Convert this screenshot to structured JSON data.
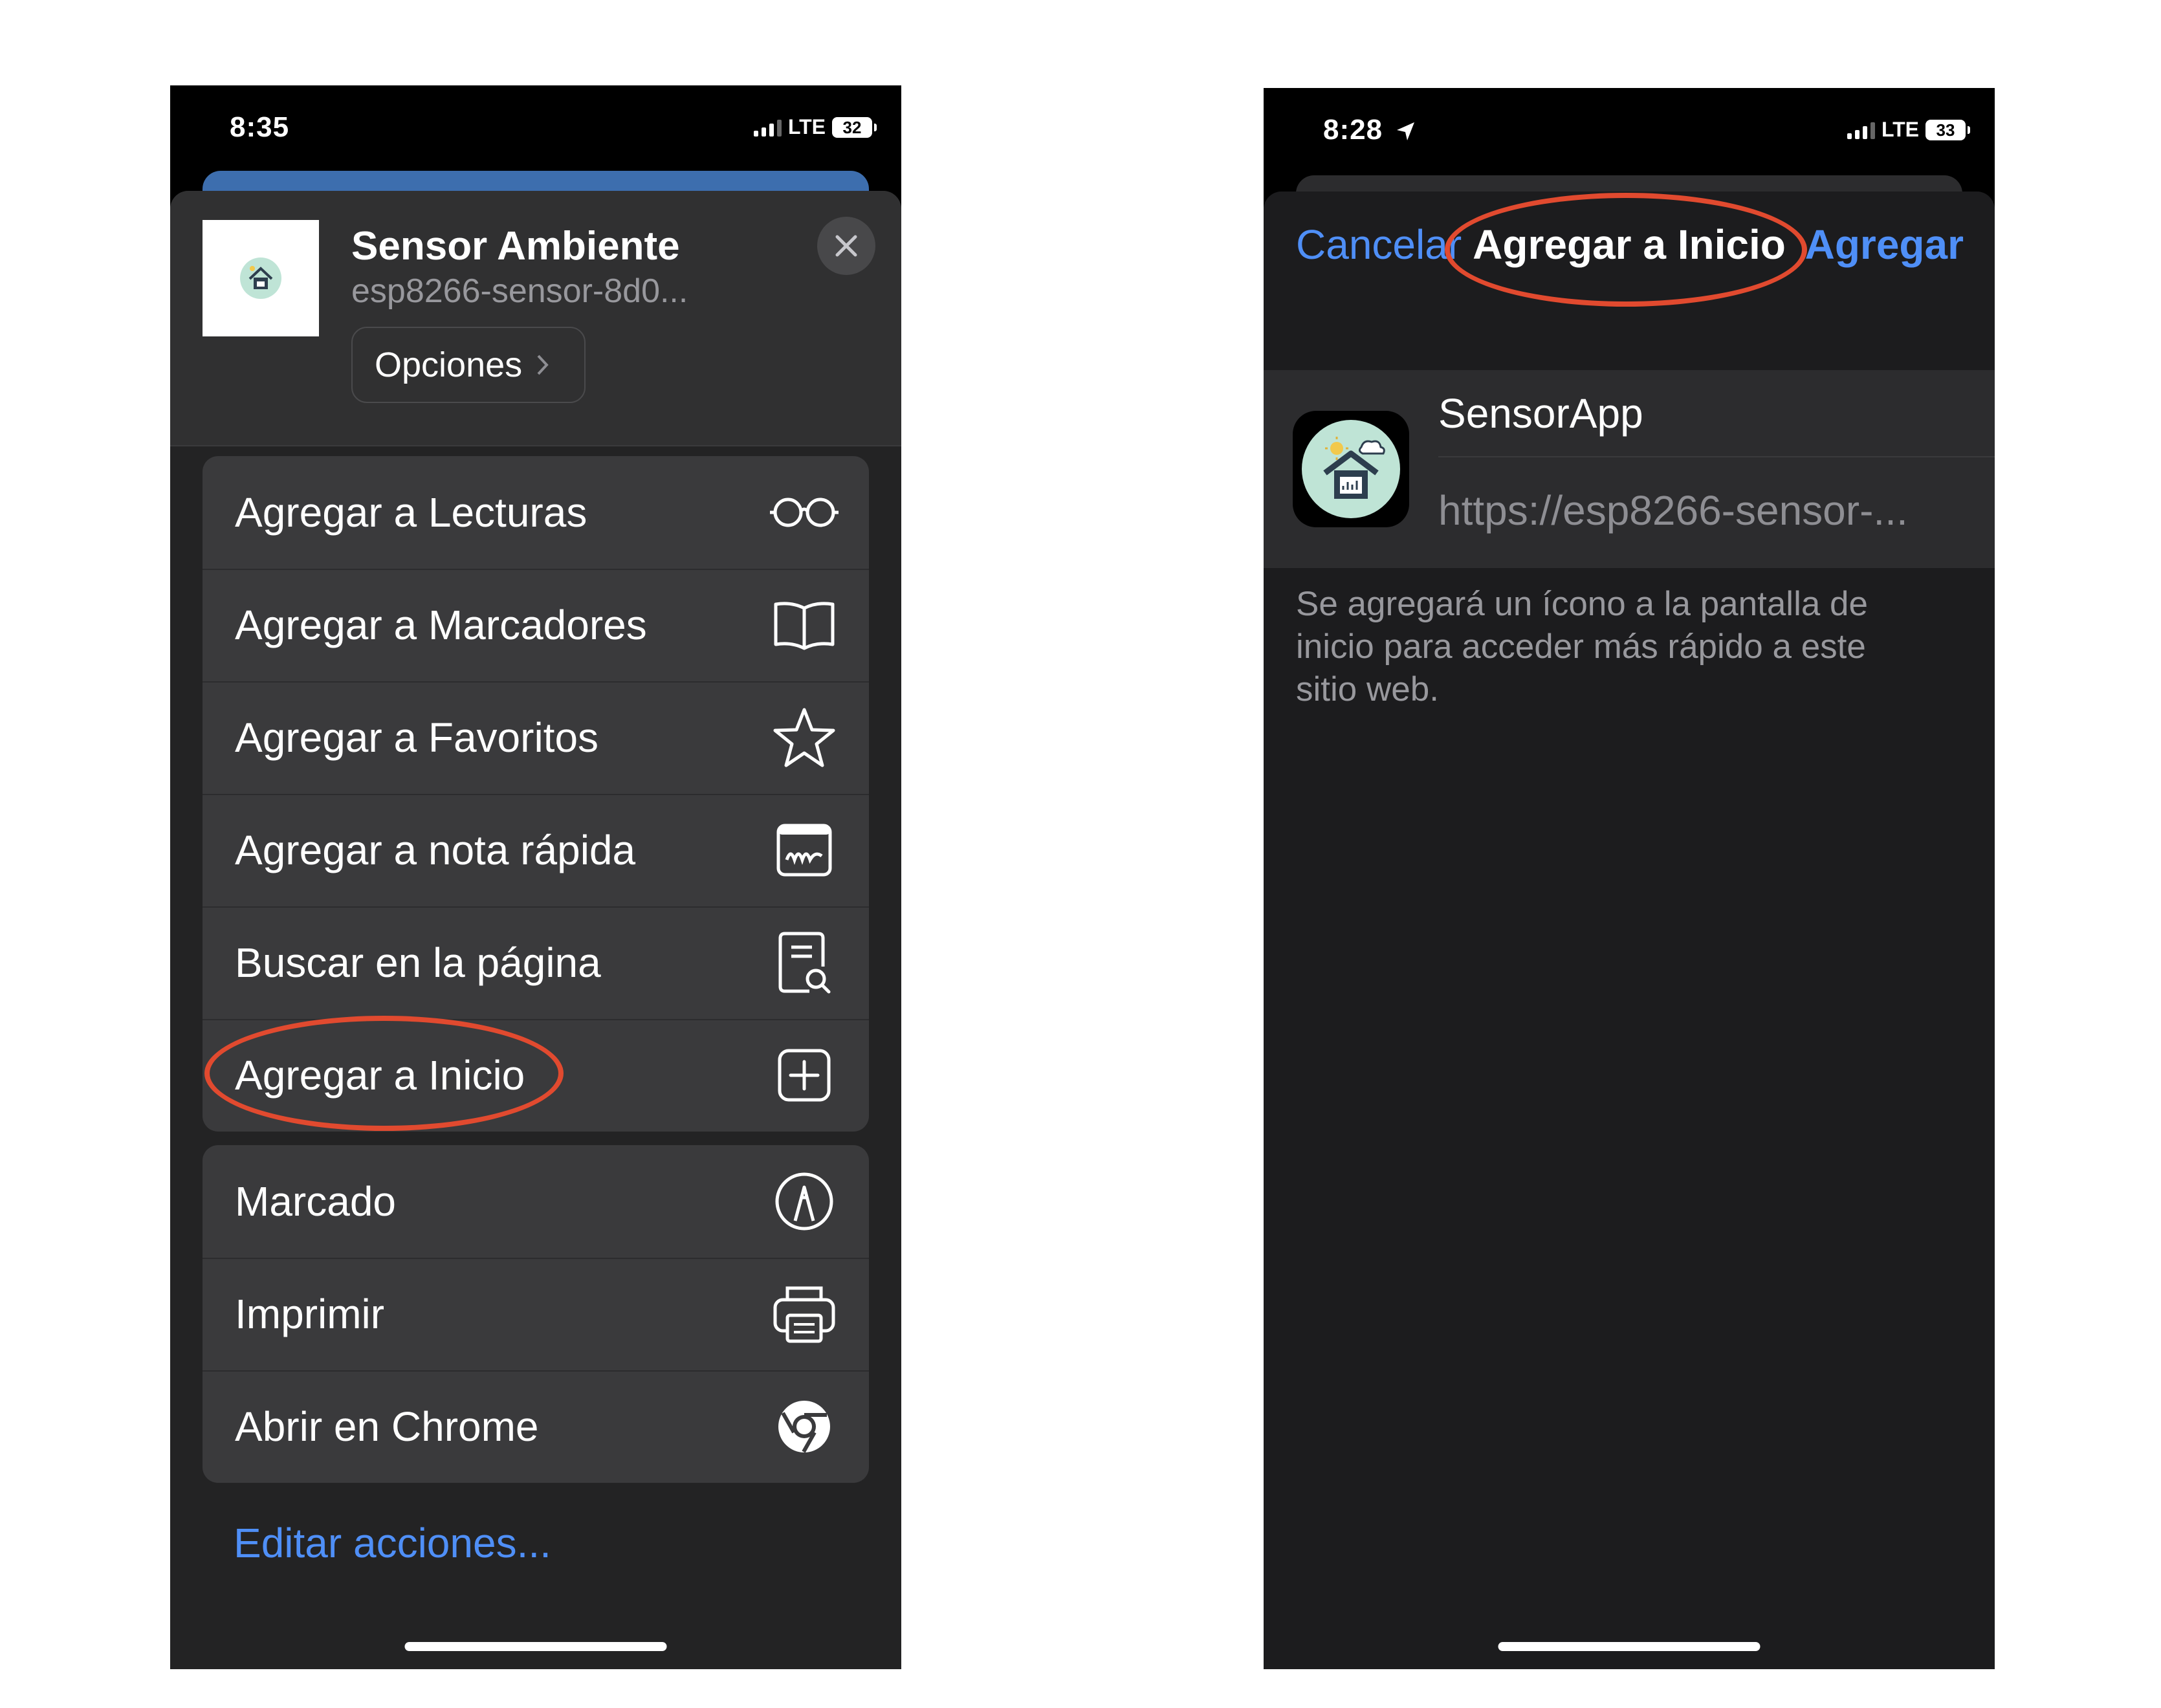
{
  "left_screen": {
    "status": {
      "time": "8:35",
      "network": "LTE",
      "battery": "32"
    },
    "share_sheet": {
      "title": "Sensor Ambiente",
      "subtitle": "esp8266-sensor-8d0...",
      "options_label": "Opciones",
      "close_icon": "close-icon"
    },
    "actions_group_1": [
      {
        "label": "Agregar a Lecturas",
        "icon": "glasses-icon"
      },
      {
        "label": "Agregar a Marcadores",
        "icon": "book-icon"
      },
      {
        "label": "Agregar a Favoritos",
        "icon": "star-icon"
      },
      {
        "label": "Agregar a nota rápida",
        "icon": "quick-note-icon"
      },
      {
        "label": "Buscar en la página",
        "icon": "find-in-page-icon"
      },
      {
        "label": "Agregar a Inicio",
        "icon": "add-square-icon"
      }
    ],
    "actions_group_2": [
      {
        "label": "Marcado",
        "icon": "markup-icon"
      },
      {
        "label": "Imprimir",
        "icon": "printer-icon"
      },
      {
        "label": "Abrir en Chrome",
        "icon": "chrome-icon"
      }
    ],
    "edit_actions_label": "Editar acciones..."
  },
  "right_screen": {
    "status": {
      "time": "8:28",
      "network": "LTE",
      "battery": "33"
    },
    "nav": {
      "cancel_label": "Cancelar",
      "title": "Agregar a Inicio",
      "add_label": "Agregar"
    },
    "app": {
      "name": "SensorApp",
      "url": "https://esp8266-sensor-..."
    },
    "info_text": "Se agregará un ícono a la pantalla de inicio para acceder más rápido a este sitio web."
  },
  "colors": {
    "accent_blue": "#4f8ff7",
    "highlight_ellipse": "#e14a2f",
    "sheet_background": "#232324",
    "row_background": "#3a3a3c"
  }
}
